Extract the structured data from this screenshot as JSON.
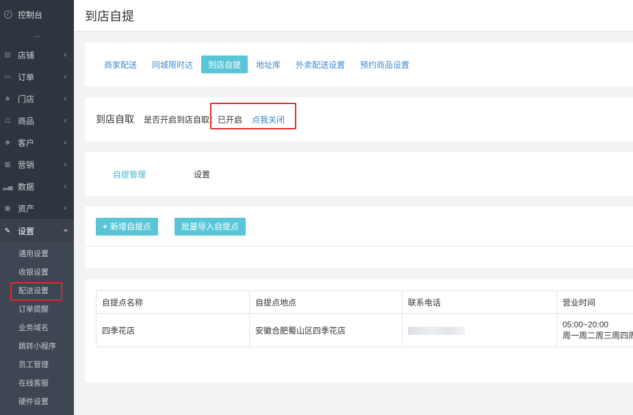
{
  "sidebar": {
    "dashboard": "控制台",
    "items": [
      {
        "label": "店铺"
      },
      {
        "label": "订单"
      },
      {
        "label": "门店"
      },
      {
        "label": "商品"
      },
      {
        "label": "客户"
      },
      {
        "label": "营销"
      },
      {
        "label": "数据"
      },
      {
        "label": "资产"
      },
      {
        "label": "设置"
      }
    ],
    "sub_items": [
      {
        "label": "通用设置"
      },
      {
        "label": "收银设置"
      },
      {
        "label": "配送设置"
      },
      {
        "label": "订单提醒"
      },
      {
        "label": "业务域名"
      },
      {
        "label": "跳转小程序"
      },
      {
        "label": "员工管理"
      },
      {
        "label": "在线客服"
      },
      {
        "label": "硬件设置"
      }
    ]
  },
  "page": {
    "title": "到店自提"
  },
  "tabs": [
    {
      "label": "商家配送"
    },
    {
      "label": "同城限时达"
    },
    {
      "label": "到店自提"
    },
    {
      "label": "地址库"
    },
    {
      "label": "外卖配送设置"
    },
    {
      "label": "预约商品设置"
    }
  ],
  "pickup": {
    "title": "到店自取",
    "question": "是否开启到店自取：已开启",
    "toggle_link": "点我关闭"
  },
  "subtabs": [
    {
      "label": "自提管理"
    },
    {
      "label": "设置"
    }
  ],
  "actions": {
    "add": "新增自提点",
    "import": "批量导入自提点"
  },
  "table": {
    "headers": [
      "自提点名称",
      "自提点地点",
      "联系电话",
      "营业时间"
    ],
    "rows": [
      {
        "name": "四季花店",
        "address": "安徽合肥蜀山区四季花店",
        "hours_time": "05:00~20:00",
        "hours_days": "周一周二周三周四周五"
      }
    ]
  },
  "colors": {
    "sidebar_bg": "#2f353f",
    "accent": "#59c6d8",
    "link": "#3d8bd0",
    "highlight": "#e02a2a"
  }
}
